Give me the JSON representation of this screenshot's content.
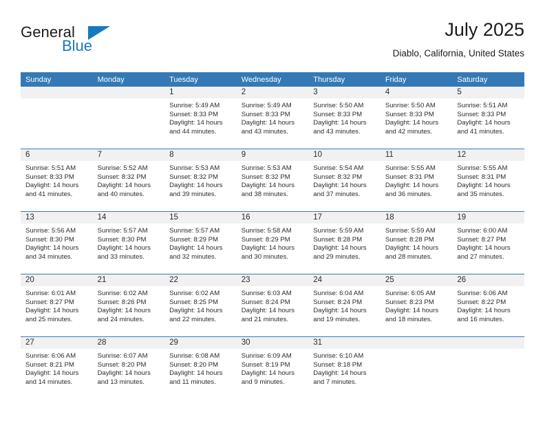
{
  "brand": {
    "name_part1": "General",
    "name_part2": "Blue",
    "flag_icon": "blue-flag-icon"
  },
  "header": {
    "title": "July 2025",
    "subtitle": "Diablo, California, United States"
  },
  "calendar": {
    "weekday_headers": [
      "Sunday",
      "Monday",
      "Tuesday",
      "Wednesday",
      "Thursday",
      "Friday",
      "Saturday"
    ],
    "colors": {
      "header_blue": "#3479b5",
      "daynum_gray": "#f1f1f1",
      "brand_blue": "#1878be",
      "text": "#2b2b2b"
    },
    "weeks": [
      [
        {
          "day": "",
          "sunrise": "",
          "sunset": "",
          "daylight_line1": "",
          "daylight_line2": ""
        },
        {
          "day": "",
          "sunrise": "",
          "sunset": "",
          "daylight_line1": "",
          "daylight_line2": ""
        },
        {
          "day": "1",
          "sunrise": "Sunrise: 5:49 AM",
          "sunset": "Sunset: 8:33 PM",
          "daylight_line1": "Daylight: 14 hours",
          "daylight_line2": "and 44 minutes."
        },
        {
          "day": "2",
          "sunrise": "Sunrise: 5:49 AM",
          "sunset": "Sunset: 8:33 PM",
          "daylight_line1": "Daylight: 14 hours",
          "daylight_line2": "and 43 minutes."
        },
        {
          "day": "3",
          "sunrise": "Sunrise: 5:50 AM",
          "sunset": "Sunset: 8:33 PM",
          "daylight_line1": "Daylight: 14 hours",
          "daylight_line2": "and 43 minutes."
        },
        {
          "day": "4",
          "sunrise": "Sunrise: 5:50 AM",
          "sunset": "Sunset: 8:33 PM",
          "daylight_line1": "Daylight: 14 hours",
          "daylight_line2": "and 42 minutes."
        },
        {
          "day": "5",
          "sunrise": "Sunrise: 5:51 AM",
          "sunset": "Sunset: 8:33 PM",
          "daylight_line1": "Daylight: 14 hours",
          "daylight_line2": "and 41 minutes."
        }
      ],
      [
        {
          "day": "6",
          "sunrise": "Sunrise: 5:51 AM",
          "sunset": "Sunset: 8:33 PM",
          "daylight_line1": "Daylight: 14 hours",
          "daylight_line2": "and 41 minutes."
        },
        {
          "day": "7",
          "sunrise": "Sunrise: 5:52 AM",
          "sunset": "Sunset: 8:32 PM",
          "daylight_line1": "Daylight: 14 hours",
          "daylight_line2": "and 40 minutes."
        },
        {
          "day": "8",
          "sunrise": "Sunrise: 5:53 AM",
          "sunset": "Sunset: 8:32 PM",
          "daylight_line1": "Daylight: 14 hours",
          "daylight_line2": "and 39 minutes."
        },
        {
          "day": "9",
          "sunrise": "Sunrise: 5:53 AM",
          "sunset": "Sunset: 8:32 PM",
          "daylight_line1": "Daylight: 14 hours",
          "daylight_line2": "and 38 minutes."
        },
        {
          "day": "10",
          "sunrise": "Sunrise: 5:54 AM",
          "sunset": "Sunset: 8:32 PM",
          "daylight_line1": "Daylight: 14 hours",
          "daylight_line2": "and 37 minutes."
        },
        {
          "day": "11",
          "sunrise": "Sunrise: 5:55 AM",
          "sunset": "Sunset: 8:31 PM",
          "daylight_line1": "Daylight: 14 hours",
          "daylight_line2": "and 36 minutes."
        },
        {
          "day": "12",
          "sunrise": "Sunrise: 5:55 AM",
          "sunset": "Sunset: 8:31 PM",
          "daylight_line1": "Daylight: 14 hours",
          "daylight_line2": "and 35 minutes."
        }
      ],
      [
        {
          "day": "13",
          "sunrise": "Sunrise: 5:56 AM",
          "sunset": "Sunset: 8:30 PM",
          "daylight_line1": "Daylight: 14 hours",
          "daylight_line2": "and 34 minutes."
        },
        {
          "day": "14",
          "sunrise": "Sunrise: 5:57 AM",
          "sunset": "Sunset: 8:30 PM",
          "daylight_line1": "Daylight: 14 hours",
          "daylight_line2": "and 33 minutes."
        },
        {
          "day": "15",
          "sunrise": "Sunrise: 5:57 AM",
          "sunset": "Sunset: 8:29 PM",
          "daylight_line1": "Daylight: 14 hours",
          "daylight_line2": "and 32 minutes."
        },
        {
          "day": "16",
          "sunrise": "Sunrise: 5:58 AM",
          "sunset": "Sunset: 8:29 PM",
          "daylight_line1": "Daylight: 14 hours",
          "daylight_line2": "and 30 minutes."
        },
        {
          "day": "17",
          "sunrise": "Sunrise: 5:59 AM",
          "sunset": "Sunset: 8:28 PM",
          "daylight_line1": "Daylight: 14 hours",
          "daylight_line2": "and 29 minutes."
        },
        {
          "day": "18",
          "sunrise": "Sunrise: 5:59 AM",
          "sunset": "Sunset: 8:28 PM",
          "daylight_line1": "Daylight: 14 hours",
          "daylight_line2": "and 28 minutes."
        },
        {
          "day": "19",
          "sunrise": "Sunrise: 6:00 AM",
          "sunset": "Sunset: 8:27 PM",
          "daylight_line1": "Daylight: 14 hours",
          "daylight_line2": "and 27 minutes."
        }
      ],
      [
        {
          "day": "20",
          "sunrise": "Sunrise: 6:01 AM",
          "sunset": "Sunset: 8:27 PM",
          "daylight_line1": "Daylight: 14 hours",
          "daylight_line2": "and 25 minutes."
        },
        {
          "day": "21",
          "sunrise": "Sunrise: 6:02 AM",
          "sunset": "Sunset: 8:26 PM",
          "daylight_line1": "Daylight: 14 hours",
          "daylight_line2": "and 24 minutes."
        },
        {
          "day": "22",
          "sunrise": "Sunrise: 6:02 AM",
          "sunset": "Sunset: 8:25 PM",
          "daylight_line1": "Daylight: 14 hours",
          "daylight_line2": "and 22 minutes."
        },
        {
          "day": "23",
          "sunrise": "Sunrise: 6:03 AM",
          "sunset": "Sunset: 8:24 PM",
          "daylight_line1": "Daylight: 14 hours",
          "daylight_line2": "and 21 minutes."
        },
        {
          "day": "24",
          "sunrise": "Sunrise: 6:04 AM",
          "sunset": "Sunset: 8:24 PM",
          "daylight_line1": "Daylight: 14 hours",
          "daylight_line2": "and 19 minutes."
        },
        {
          "day": "25",
          "sunrise": "Sunrise: 6:05 AM",
          "sunset": "Sunset: 8:23 PM",
          "daylight_line1": "Daylight: 14 hours",
          "daylight_line2": "and 18 minutes."
        },
        {
          "day": "26",
          "sunrise": "Sunrise: 6:06 AM",
          "sunset": "Sunset: 8:22 PM",
          "daylight_line1": "Daylight: 14 hours",
          "daylight_line2": "and 16 minutes."
        }
      ],
      [
        {
          "day": "27",
          "sunrise": "Sunrise: 6:06 AM",
          "sunset": "Sunset: 8:21 PM",
          "daylight_line1": "Daylight: 14 hours",
          "daylight_line2": "and 14 minutes."
        },
        {
          "day": "28",
          "sunrise": "Sunrise: 6:07 AM",
          "sunset": "Sunset: 8:20 PM",
          "daylight_line1": "Daylight: 14 hours",
          "daylight_line2": "and 13 minutes."
        },
        {
          "day": "29",
          "sunrise": "Sunrise: 6:08 AM",
          "sunset": "Sunset: 8:20 PM",
          "daylight_line1": "Daylight: 14 hours",
          "daylight_line2": "and 11 minutes."
        },
        {
          "day": "30",
          "sunrise": "Sunrise: 6:09 AM",
          "sunset": "Sunset: 8:19 PM",
          "daylight_line1": "Daylight: 14 hours",
          "daylight_line2": "and 9 minutes."
        },
        {
          "day": "31",
          "sunrise": "Sunrise: 6:10 AM",
          "sunset": "Sunset: 8:18 PM",
          "daylight_line1": "Daylight: 14 hours",
          "daylight_line2": "and 7 minutes."
        },
        {
          "day": "",
          "sunrise": "",
          "sunset": "",
          "daylight_line1": "",
          "daylight_line2": ""
        },
        {
          "day": "",
          "sunrise": "",
          "sunset": "",
          "daylight_line1": "",
          "daylight_line2": ""
        }
      ]
    ]
  }
}
